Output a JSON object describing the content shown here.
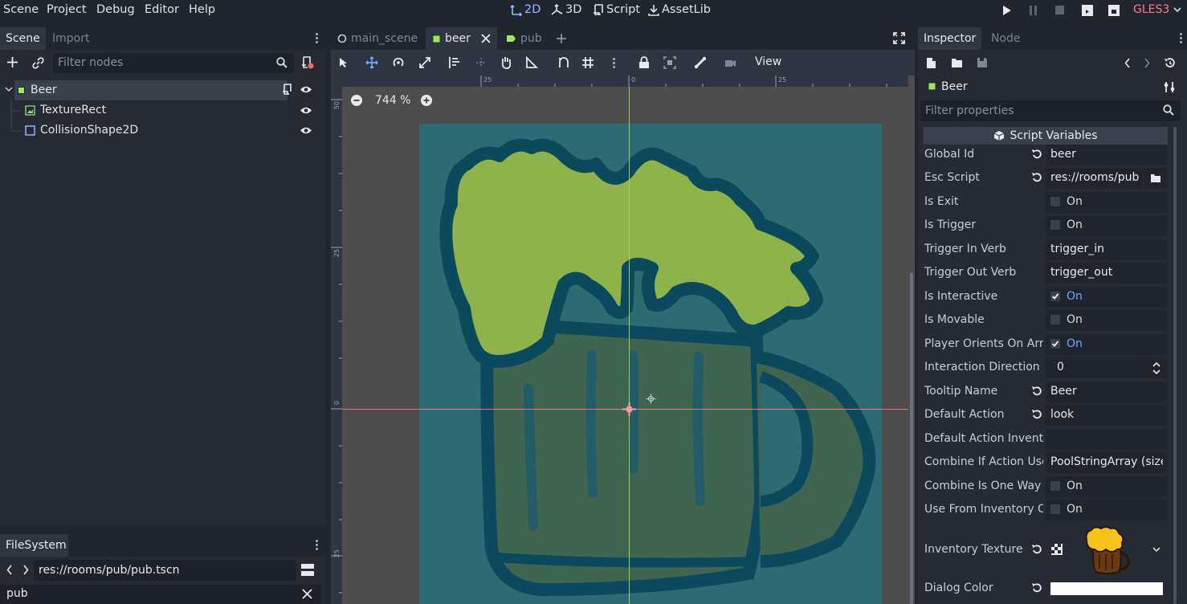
{
  "menu": [
    "Scene",
    "Project",
    "Debug",
    "Editor",
    "Help"
  ],
  "workspaces": {
    "w2d": "2D",
    "w3d": "3D",
    "script": "Script",
    "assetlib": "AssetLib"
  },
  "renderer": "GLES3",
  "scene_dock": {
    "tabs": {
      "scene": "Scene",
      "import": "Import"
    },
    "filter_placeholder": "Filter nodes",
    "nodes": [
      {
        "label": "Beer",
        "type": "Area2D"
      },
      {
        "label": "TextureRect",
        "type": "TextureRect"
      },
      {
        "label": "CollisionShape2D",
        "type": "CollisionShape2D"
      }
    ]
  },
  "filesystem": {
    "tab": "FileSystem",
    "path": "res://rooms/pub/pub.tscn",
    "search": "pub"
  },
  "editor": {
    "tabs": [
      {
        "label": "main_scene",
        "icon": "node-circle-icon"
      },
      {
        "label": "beer",
        "icon": "area2d-icon"
      },
      {
        "label": "pub",
        "icon": "control-icon"
      }
    ],
    "view_menu": "View",
    "zoom": "744 %",
    "ruler_h": [
      "25",
      "0",
      "25"
    ],
    "ruler_v": [
      "50",
      "25",
      "0",
      "25"
    ],
    "colors": {
      "canvas_bg": "#4d4d4d",
      "texture_bg": "#2d6a72",
      "foam": "#8db34a",
      "mug_fill": "#3f6450",
      "outline": "#0b4a5c"
    }
  },
  "inspector": {
    "tabs": {
      "inspector": "Inspector",
      "node": "Node"
    },
    "node_name": "Beer",
    "filter_placeholder": "Filter properties",
    "section": "Script Variables",
    "props": [
      {
        "label": "Global Id",
        "kind": "text",
        "value": "beer",
        "revert": true
      },
      {
        "label": "Esc Script",
        "kind": "file",
        "value": "res://rooms/pub",
        "revert": true
      },
      {
        "label": "Is Exit",
        "kind": "check",
        "checked": false,
        "value": "On"
      },
      {
        "label": "Is Trigger",
        "kind": "check",
        "checked": false,
        "value": "On"
      },
      {
        "label": "Trigger In Verb",
        "kind": "text",
        "value": "trigger_in"
      },
      {
        "label": "Trigger Out Verb",
        "kind": "text",
        "value": "trigger_out"
      },
      {
        "label": "Is Interactive",
        "kind": "check",
        "checked": true,
        "value": "On"
      },
      {
        "label": "Is Movable",
        "kind": "check",
        "checked": false,
        "value": "On"
      },
      {
        "label": "Player Orients On Arri",
        "kind": "check",
        "checked": true,
        "value": "On"
      },
      {
        "label": "Interaction Direction",
        "kind": "spin",
        "value": "0"
      },
      {
        "label": "Tooltip Name",
        "kind": "text",
        "value": "Beer",
        "revert": true
      },
      {
        "label": "Default Action",
        "kind": "text",
        "value": "look",
        "revert": true
      },
      {
        "label": "Default Action Invento",
        "kind": "text",
        "value": ""
      },
      {
        "label": "Combine If Action Use",
        "kind": "text",
        "value": "PoolStringArray (size"
      },
      {
        "label": "Combine Is One Way",
        "kind": "check",
        "checked": false,
        "value": "On"
      },
      {
        "label": "Use From Inventory O",
        "kind": "check",
        "checked": false,
        "value": "On"
      }
    ],
    "inventory_texture_label": "Inventory Texture",
    "dialog_color_label": "Dialog Color",
    "dialog_color": "#ffffff"
  }
}
